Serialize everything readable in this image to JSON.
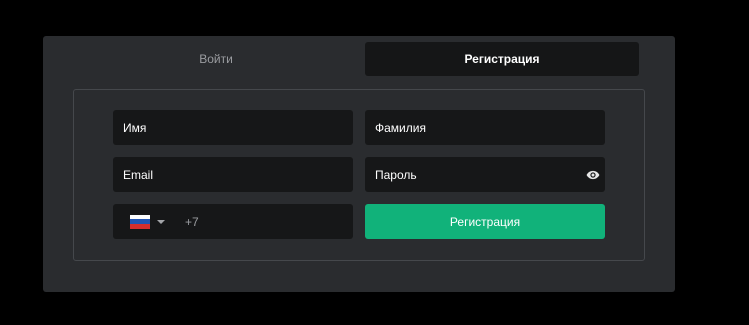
{
  "tabs": {
    "login": "Войти",
    "register": "Регистрация"
  },
  "fields": {
    "first_name": "Имя",
    "last_name": "Фамилия",
    "email": "Email",
    "password": "Пароль",
    "phone_prefix": "+7"
  },
  "country": {
    "selected": "ru",
    "flag_colors": [
      "#ffffff",
      "#2255b3",
      "#d62e2e"
    ]
  },
  "icons": {
    "password_toggle": "eye-icon",
    "country_dropdown": "chevron-down-icon"
  },
  "submit_label": "Регистрация",
  "colors": {
    "background": "#000000",
    "panel": "#2a2c2f",
    "field": "#161718",
    "accent": "#11b27a"
  }
}
